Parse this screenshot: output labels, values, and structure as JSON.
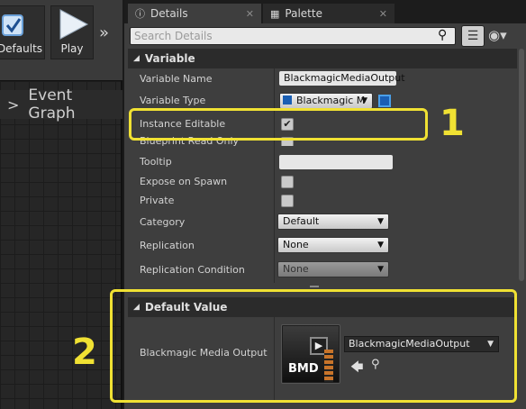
{
  "toolbar": {
    "defaults_label": "Defaults",
    "play_label": "Play",
    "more_glyph": "»"
  },
  "graph": {
    "tab_label": "Event Graph"
  },
  "tabs": {
    "details_label": "Details",
    "palette_label": "Palette",
    "close_glyph": "✕"
  },
  "search": {
    "placeholder": "Search Details"
  },
  "variable_section": {
    "title": "Variable",
    "rows": {
      "variable_name": {
        "label": "Variable Name",
        "value": "BlackmagicMediaOutput"
      },
      "variable_type": {
        "label": "Variable Type",
        "value": "Blackmagic M"
      },
      "instance_editable": {
        "label": "Instance Editable",
        "checked": true
      },
      "blueprint_read_only": {
        "label": "Blueprint Read Only"
      },
      "tooltip": {
        "label": "Tooltip",
        "value": ""
      },
      "expose_on_spawn": {
        "label": "Expose on Spawn"
      },
      "private": {
        "label": "Private"
      },
      "category": {
        "label": "Category",
        "value": "Default"
      },
      "replication": {
        "label": "Replication",
        "value": "None"
      },
      "replication_condition": {
        "label": "Replication Condition",
        "value": "None"
      }
    }
  },
  "default_value_section": {
    "title": "Default Value",
    "row_label": "Blackmagic Media Output",
    "asset_value": "BlackmagicMediaOutput",
    "thumbnail_text": "BMD"
  },
  "annotations": {
    "callout_1": "1",
    "callout_2": "2",
    "highlight_color": "#f0e133"
  },
  "icons": {
    "details_tab": "info-icon",
    "palette_tab": "grid-icon",
    "search": "search-icon",
    "list_view": "list-icon",
    "visibility": "eye-icon",
    "use_selected": "arrow-left-icon",
    "browse": "magnifier-icon",
    "play": "play-icon",
    "defaults": "checkbox-icon"
  }
}
